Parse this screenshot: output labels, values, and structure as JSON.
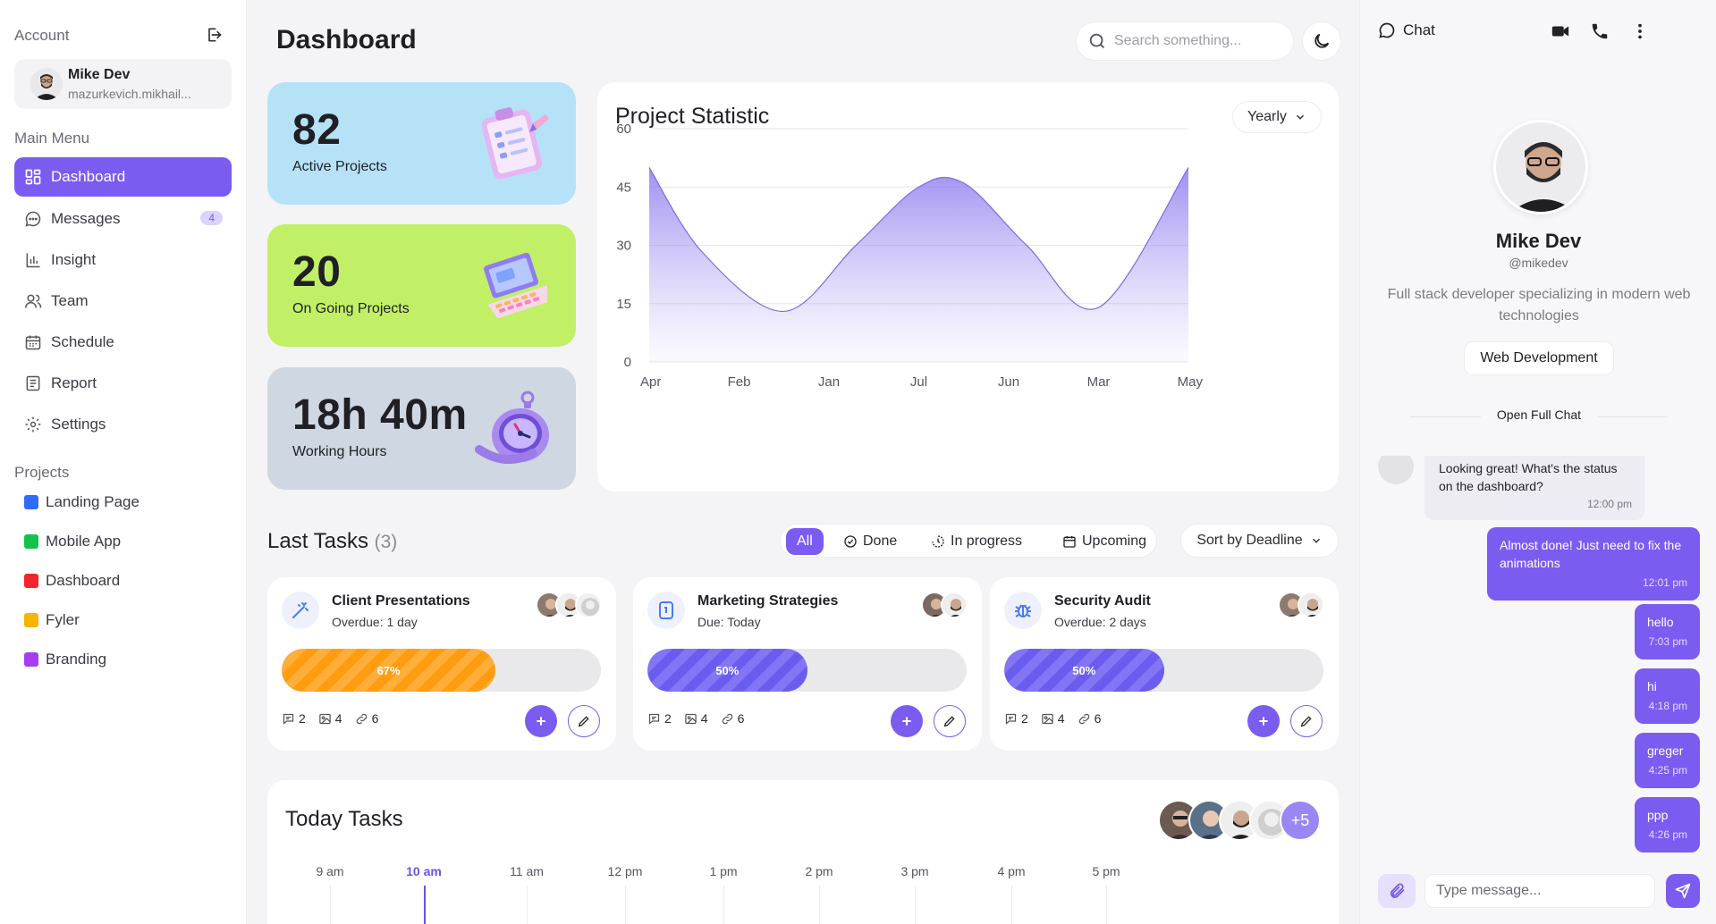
{
  "colors": {
    "accent": "#7b5cf0",
    "card_blue": "#b6e2f7",
    "card_green": "#c1f067",
    "card_gray": "#cfd7e3"
  },
  "sidebar": {
    "account_heading": "Account",
    "user": {
      "name": "Mike Dev",
      "email": "mazurkevich.mikhail..."
    },
    "main_menu_heading": "Main Menu",
    "menu": [
      {
        "label": "Dashboard",
        "icon": "grid-icon",
        "active": true
      },
      {
        "label": "Messages",
        "icon": "message-icon",
        "badge": "4"
      },
      {
        "label": "Insight",
        "icon": "bar-chart-icon"
      },
      {
        "label": "Team",
        "icon": "team-icon"
      },
      {
        "label": "Schedule",
        "icon": "calendar-icon"
      },
      {
        "label": "Report",
        "icon": "report-icon"
      },
      {
        "label": "Settings",
        "icon": "gear-icon"
      }
    ],
    "projects_heading": "Projects",
    "projects": [
      {
        "label": "Landing Page",
        "color": "#2f6df6"
      },
      {
        "label": "Mobile App",
        "color": "#14c14a"
      },
      {
        "label": "Dashboard",
        "color": "#f4242e"
      },
      {
        "label": "Fyler",
        "color": "#f7b500"
      },
      {
        "label": "Branding",
        "color": "#a53df2"
      }
    ]
  },
  "header": {
    "title": "Dashboard",
    "search_placeholder": "Search something..."
  },
  "stats": [
    {
      "value": "82",
      "label": "Active Projects",
      "icon": "clipboard-icon"
    },
    {
      "value": "20",
      "label": "On Going Projects",
      "icon": "laptop-icon"
    },
    {
      "value": "18h 40m",
      "label": "Working Hours",
      "icon": "stopwatch-icon"
    }
  ],
  "chart_card": {
    "title": "Project Statistic",
    "period": "Yearly"
  },
  "chart_data": {
    "type": "area",
    "x": [
      "Apr",
      "Feb",
      "Jan",
      "Jul",
      "Jun",
      "Mar",
      "May"
    ],
    "points": [
      [
        0,
        50
      ],
      [
        0.6,
        28
      ],
      [
        1.5,
        13
      ],
      [
        2.3,
        30
      ],
      [
        3.0,
        45
      ],
      [
        3.5,
        46
      ],
      [
        4.2,
        30
      ],
      [
        5.0,
        14
      ],
      [
        6.0,
        50
      ]
    ],
    "yticks": [
      0,
      15,
      30,
      45,
      60
    ],
    "ylim": [
      0,
      60
    ],
    "grid": true,
    "color": "#7b5cf0"
  },
  "last_tasks": {
    "title": "Last Tasks",
    "count": "(3)",
    "filters": [
      "All",
      "Done",
      "In progress",
      "Upcoming"
    ],
    "sort": "Sort by Deadline",
    "items": [
      {
        "name": "Client Presentations",
        "due": "Overdue: 1 day",
        "progress": 67,
        "progress_label": "67%",
        "comments": "2",
        "images": "4",
        "links": "6",
        "icon": "wand-icon",
        "color": "orange"
      },
      {
        "name": "Marketing Strategies",
        "due": "Due: Today",
        "progress": 50,
        "progress_label": "50%",
        "comments": "2",
        "images": "4",
        "links": "6",
        "icon": "tablet-icon",
        "color": "purple"
      },
      {
        "name": "Security Audit",
        "due": "Overdue: 2 days",
        "progress": 50,
        "progress_label": "50%",
        "comments": "2",
        "images": "4",
        "links": "6",
        "icon": "bug-icon",
        "color": "purple"
      }
    ]
  },
  "today_tasks": {
    "title": "Today Tasks",
    "extra_members": "+5",
    "times": [
      "9 am",
      "10 am",
      "11 am",
      "12 pm",
      "1 pm",
      "2 pm",
      "3 pm",
      "4 pm",
      "5 pm"
    ],
    "current": "10 am"
  },
  "chat": {
    "title": "Chat",
    "profile": {
      "name": "Mike Dev",
      "handle": "@mikedev",
      "bio": "Full stack developer specializing in modern web technologies",
      "tag": "Web Development"
    },
    "open_full": "Open Full Chat",
    "messages": [
      {
        "from": "them",
        "text": "Looking great! What's the status on the dashboard?",
        "time": "12:00 pm"
      },
      {
        "from": "me",
        "text": "Almost done! Just need to fix the animations",
        "time": "12:01 pm"
      },
      {
        "from": "me",
        "text": "hello",
        "time": "7:03 pm"
      },
      {
        "from": "me",
        "text": "hi",
        "time": "4:18 pm"
      },
      {
        "from": "me",
        "text": "greger",
        "time": "4:25 pm"
      },
      {
        "from": "me",
        "text": "ppp",
        "time": "4:26 pm"
      }
    ],
    "input_placeholder": "Type message..."
  }
}
